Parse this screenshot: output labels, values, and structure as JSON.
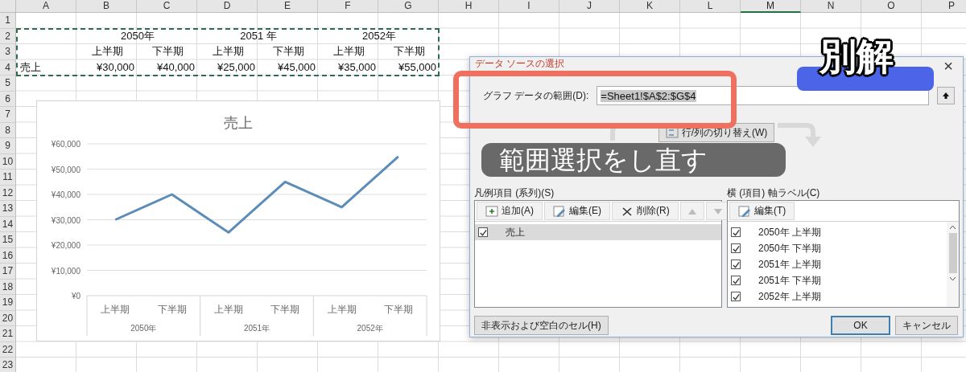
{
  "sheet": {
    "columns": [
      {
        "label": "A",
        "selected": false
      },
      {
        "label": "B",
        "selected": false
      },
      {
        "label": "C",
        "selected": false
      },
      {
        "label": "D",
        "selected": false
      },
      {
        "label": "E",
        "selected": false
      },
      {
        "label": "F",
        "selected": false
      },
      {
        "label": "G",
        "selected": false
      },
      {
        "label": "H",
        "selected": false
      },
      {
        "label": "I",
        "selected": false
      },
      {
        "label": "J",
        "selected": false
      },
      {
        "label": "K",
        "selected": false
      },
      {
        "label": "L",
        "selected": false
      },
      {
        "label": "M",
        "selected": true
      },
      {
        "label": "N",
        "selected": false
      },
      {
        "label": "O",
        "selected": false
      },
      {
        "label": "P",
        "selected": false
      }
    ],
    "rows": [
      "1",
      "2",
      "3",
      "4",
      "5",
      "6",
      "7",
      "8",
      "9",
      "10",
      "11",
      "12",
      "13",
      "14",
      "15",
      "16",
      "17",
      "18",
      "19",
      "20",
      "21",
      "22",
      "23"
    ],
    "year_headers": [
      "2050年",
      "2051 年",
      "2052年"
    ],
    "period_headers": [
      "上半期",
      "下半期",
      "上半期",
      "下半期",
      "上半期",
      "下半期"
    ],
    "row_label": "売上",
    "values": [
      "¥30,000",
      "¥40,000",
      "¥25,000",
      "¥45,000",
      "¥35,000",
      "¥55,000"
    ],
    "copy_marquee": true
  },
  "chart": {
    "category_groups": [
      "2050年",
      "2051年",
      "2052年"
    ],
    "chart_data": {
      "type": "line",
      "title": "売上",
      "categories": [
        "上半期",
        "下半期",
        "上半期",
        "下半期",
        "上半期",
        "下半期"
      ],
      "series": [
        {
          "color": "#5b8db8",
          "values": [
            30000,
            40000,
            25000,
            45000,
            35000,
            55000
          ]
        }
      ],
      "grid": true,
      "ylim": [
        0,
        60000
      ],
      "yticks": [
        {
          "value": 0,
          "label": "¥0"
        },
        {
          "value": 10000,
          "label": "¥10,000"
        },
        {
          "value": 20000,
          "label": "¥20,000"
        },
        {
          "value": 30000,
          "label": "¥30,000"
        },
        {
          "value": 40000,
          "label": "¥40,000"
        },
        {
          "value": 50000,
          "label": "¥50,000"
        },
        {
          "value": 60000,
          "label": "¥60,000"
        }
      ]
    }
  },
  "dialog": {
    "title": "データ ソースの選択",
    "close": "×",
    "range_label": "グラフ データの範囲(D):",
    "range_value": "=Sheet1!$A$2:$G$4",
    "switch_button": "行/列の切り替え(W)",
    "series_heading": "凡例項目 (系列)(S)",
    "series_toolbar": [
      {
        "kind": "add",
        "label": "追加(A)",
        "disabled": false
      },
      {
        "kind": "edit",
        "label": "編集(E)",
        "disabled": false
      },
      {
        "kind": "delete",
        "label": "削除(R)",
        "disabled": false
      },
      {
        "kind": "up",
        "disabled": true
      },
      {
        "kind": "down",
        "disabled": true
      }
    ],
    "series": [
      {
        "label": "売上",
        "checked": true,
        "selected": true
      }
    ],
    "axis_heading": "横 (項目) 軸ラベル(C)",
    "axis_toolbar": [
      {
        "kind": "edit",
        "label": "編集(T)",
        "disabled": false
      }
    ],
    "axis_labels": [
      {
        "label": "2050年 上半期",
        "checked": true,
        "selected": false
      },
      {
        "label": "2050年 下半期",
        "checked": true,
        "selected": false
      },
      {
        "label": "2051年 上半期",
        "checked": true,
        "selected": false
      },
      {
        "label": "2051年 下半期",
        "checked": true,
        "selected": false
      },
      {
        "label": "2052年 上半期",
        "checked": true,
        "selected": false
      }
    ],
    "hidden_cells_button": "非表示および空白のセル(H)",
    "ok_button": "OK",
    "cancel_button": "キャンセル"
  },
  "annotations": {
    "alternate_label": "別解",
    "caption": "範囲選択をし直す"
  }
}
